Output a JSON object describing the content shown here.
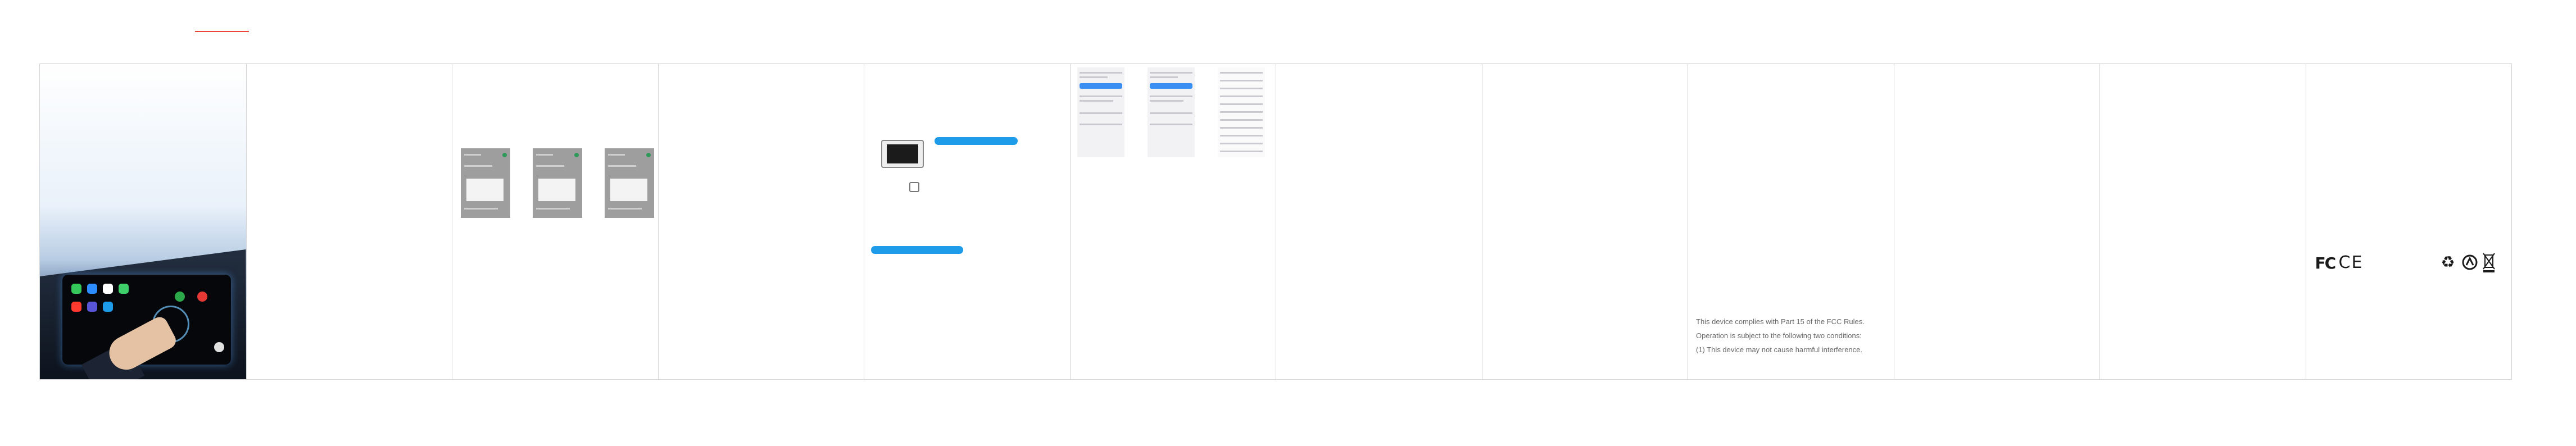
{
  "icons": {
    "ce": "ce-mark-icon",
    "fcc": "fcc-logo-icon",
    "recycle": "recycle-icon",
    "weee": "weee-bin-icon",
    "triman": "triman-icon"
  },
  "compliance": {
    "line1": "This device complies with Part 15 of the FCC Rules.",
    "line2": "Operation is subject to the following two conditions:",
    "line3": "(1) This device may not cause harmful interference."
  },
  "marks": {
    "fcc": "FC",
    "ce": "CE"
  },
  "colors": {
    "accent_red": "#e8473a",
    "highlight_blue": "#1e9be9",
    "panel_border": "#d4d4d4"
  }
}
